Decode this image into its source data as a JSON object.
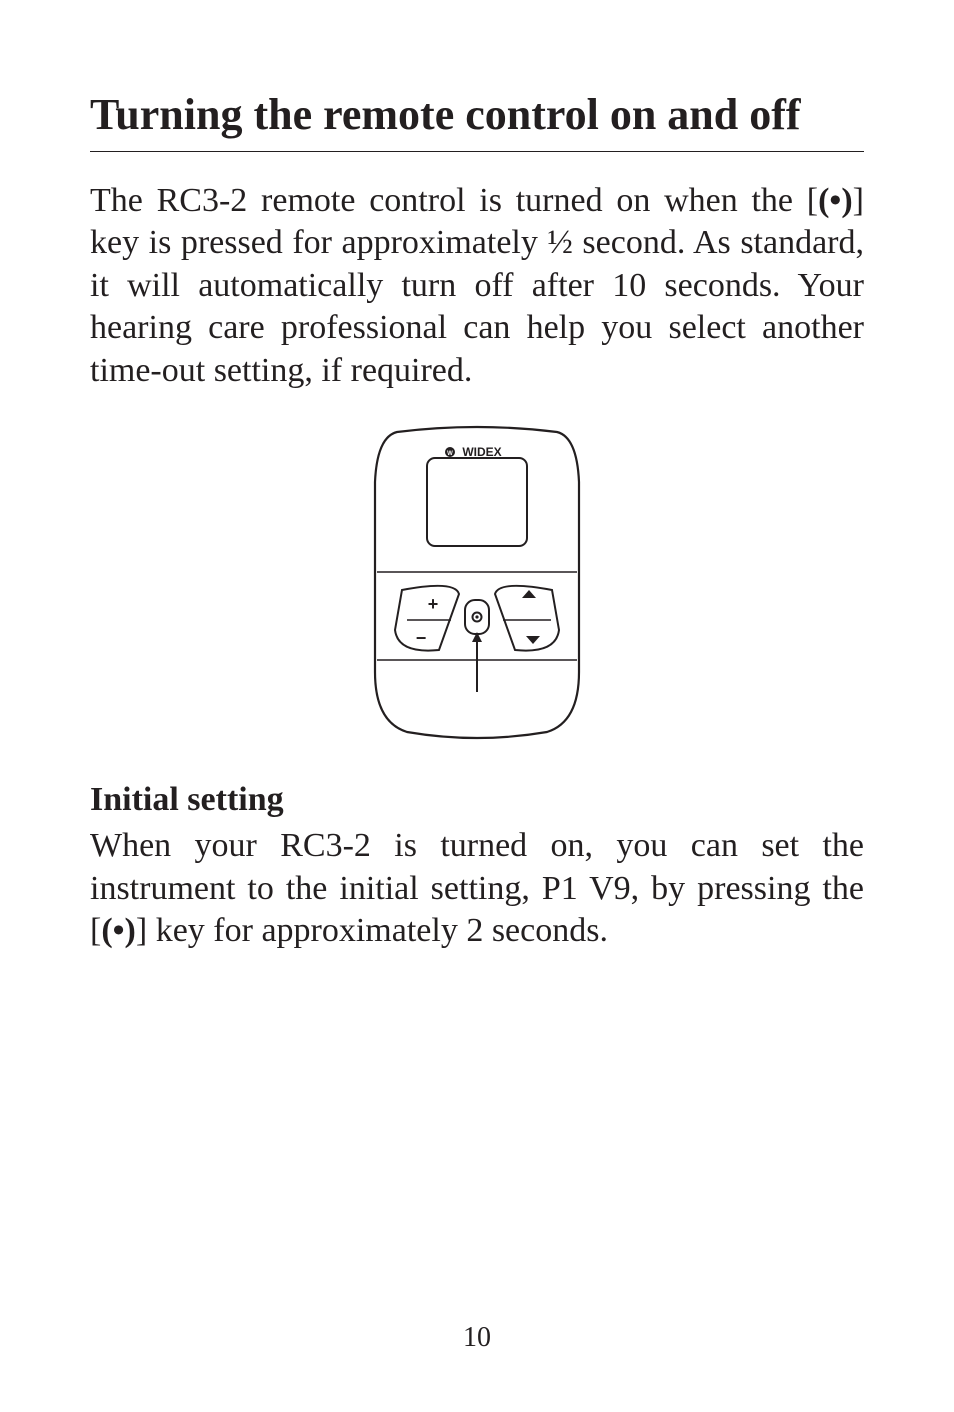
{
  "title": "Turning the remote control on and off",
  "para1_parts": {
    "a": "The RC3-2 remote control is turned on when the [",
    "key": "(•)",
    "b": "] key is pressed for approximately ½ second. As standard, it will automatically turn off after 10 seconds. Your hearing care professional can help you select another time-out setting, if required."
  },
  "device": {
    "brand_logo_text": "WIDEX",
    "buttons": {
      "volume_plus": "+",
      "volume_minus": "−",
      "center_dot": "•",
      "program_up": "▲",
      "program_down": "▼"
    }
  },
  "subhead": "Initial setting",
  "para2_parts": {
    "a": "When your RC3-2 is turned on, you can set the instrument to the initial setting, P1 V9, by pressing the [",
    "key": "(•)",
    "b": "] key for approximately 2 seconds."
  },
  "page_number": "10"
}
